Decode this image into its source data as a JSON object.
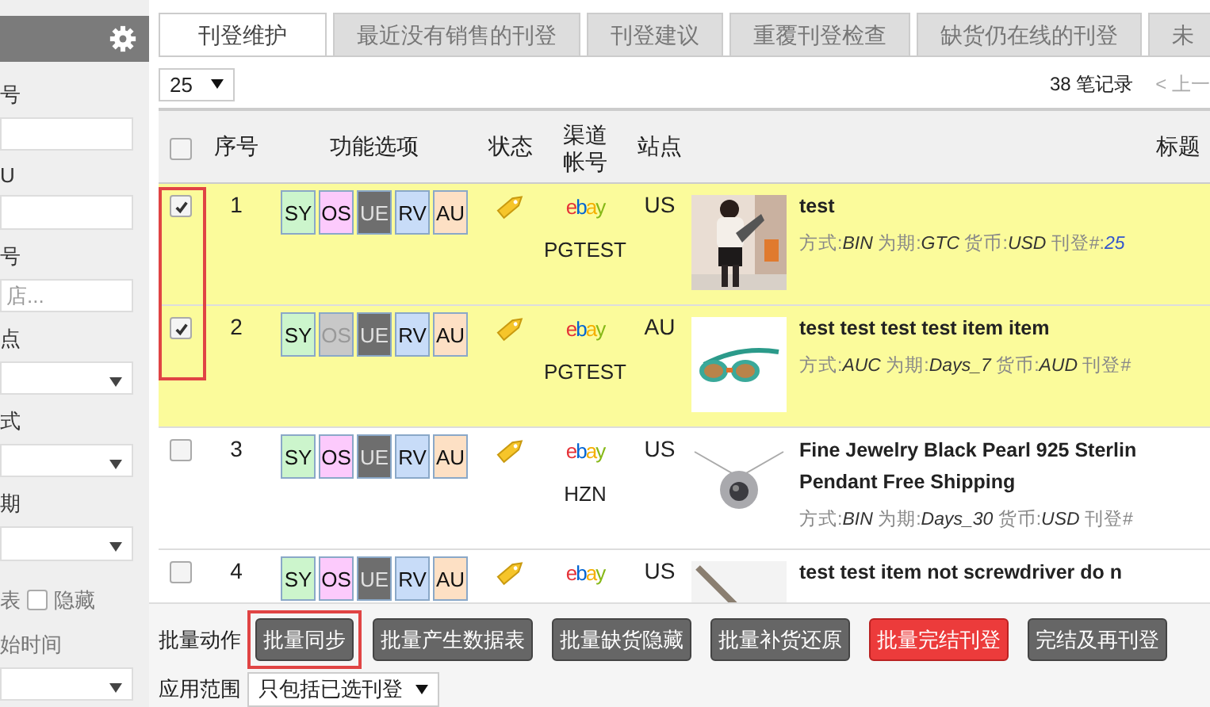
{
  "sidebar": {
    "fields": [
      {
        "kind": "input",
        "label": "号"
      },
      {
        "kind": "input",
        "label": "U"
      },
      {
        "kind": "input",
        "label": "号",
        "placeholder": "店..."
      },
      {
        "kind": "select",
        "label": "点"
      },
      {
        "kind": "select",
        "label": "式"
      },
      {
        "kind": "select",
        "label": "期"
      },
      {
        "kind": "checkbox",
        "prefix": "表",
        "label": "隐藏",
        "checked": false
      },
      {
        "kind": "select",
        "label": "始时间"
      }
    ]
  },
  "tabs": [
    {
      "label": "刊登维护",
      "selected": true
    },
    {
      "label": "最近没有销售的刊登",
      "selected": false
    },
    {
      "label": "刊登建议",
      "selected": false
    },
    {
      "label": "重覆刊登检查",
      "selected": false
    },
    {
      "label": "缺货仍在线的刊登",
      "selected": false
    },
    {
      "label": "未",
      "selected": false
    }
  ],
  "toolbar": {
    "page_size": "25",
    "record_count": "38 笔记录",
    "prev_page": "< 上一"
  },
  "table": {
    "select_all_checked": false,
    "columns": [
      "序号",
      "功能选项",
      "状态",
      "渠道帐号",
      "站点",
      "标题"
    ],
    "rows": [
      {
        "checked": true,
        "annotated": true,
        "index": "1",
        "actions": [
          {
            "code": "SY",
            "color": "#ccf5cc",
            "disabled": false
          },
          {
            "code": "OS",
            "color": "#fccafc",
            "disabled": false
          },
          {
            "code": "UE",
            "color": "#6e6e6e",
            "disabled": false
          },
          {
            "code": "RV",
            "color": "#c8dcf8",
            "disabled": false
          },
          {
            "code": "AU",
            "color": "#fde0c4",
            "disabled": false
          }
        ],
        "channel": {
          "kind": "ebay",
          "logo": "ebay"
        },
        "account": "PGTEST",
        "site": "US",
        "image": {
          "kind": "person"
        },
        "title": "test",
        "meta": [
          {
            "label": "方式:",
            "value": "BIN"
          },
          {
            "label": "为期:",
            "value": "GTC"
          },
          {
            "label": "货币:",
            "value": "USD"
          },
          {
            "label": "刊登#:",
            "value": "25"
          }
        ]
      },
      {
        "checked": true,
        "annotated": true,
        "index": "2",
        "actions": [
          {
            "code": "SY",
            "color": "#ccf5cc",
            "disabled": false
          },
          {
            "code": "OS",
            "disabled": true
          },
          {
            "code": "UE",
            "color": "#6e6e6e",
            "disabled": false
          },
          {
            "code": "RV",
            "color": "#c8dcf8",
            "disabled": false
          },
          {
            "code": "AU",
            "color": "#fde0c4",
            "disabled": false
          }
        ],
        "channel": {
          "kind": "ebay",
          "logo": "ebay"
        },
        "account": "PGTEST",
        "site": "AU",
        "image": {
          "kind": "goggles"
        },
        "title": "test test test test item item",
        "meta": [
          {
            "label": "方式:",
            "value": "AUC"
          },
          {
            "label": "为期:",
            "value": "Days_7"
          },
          {
            "label": "货币:",
            "value": "AUD"
          },
          {
            "label": "刊登#"
          }
        ]
      },
      {
        "checked": false,
        "annotated": false,
        "index": "3",
        "actions": [
          {
            "code": "SY",
            "color": "#ccf5cc",
            "disabled": false
          },
          {
            "code": "OS",
            "color": "#fccafc",
            "disabled": false
          },
          {
            "code": "UE",
            "color": "#6e6e6e",
            "disabled": false
          },
          {
            "code": "RV",
            "color": "#c8dcf8",
            "disabled": false
          },
          {
            "code": "AU",
            "color": "#fde0c4",
            "disabled": false
          }
        ],
        "channel": {
          "kind": "ebay",
          "logo": "ebay"
        },
        "account": "HZN",
        "site": "US",
        "image": {
          "kind": "pendant"
        },
        "title": "Fine Jewelry Black Pearl 925 Sterlin Pendant Free Shipping",
        "meta": [
          {
            "label": "方式:",
            "value": "BIN"
          },
          {
            "label": "为期:",
            "value": "Days_30"
          },
          {
            "label": "货币:",
            "value": "USD"
          },
          {
            "label": "刊登#"
          }
        ]
      },
      {
        "checked": false,
        "annotated": false,
        "index": "4",
        "actions": [
          {
            "code": "SY",
            "color": "#ccf5cc",
            "disabled": false
          },
          {
            "code": "OS",
            "color": "#fccafc",
            "disabled": false
          },
          {
            "code": "UE",
            "color": "#6e6e6e",
            "disabled": false
          },
          {
            "code": "RV",
            "color": "#c8dcf8",
            "disabled": false
          },
          {
            "code": "AU",
            "color": "#fde0c4",
            "disabled": false
          }
        ],
        "channel": {
          "kind": "ebay",
          "logo": "ebay"
        },
        "site": "US",
        "image": {
          "kind": "tool"
        },
        "title": "test test item not screwdriver do n"
      }
    ]
  },
  "batch": {
    "label": "批量动作",
    "buttons": [
      {
        "label": "批量同步",
        "kind": "normal",
        "highlighted": true
      },
      {
        "label": "批量产生数据表",
        "kind": "normal",
        "highlighted": false
      },
      {
        "label": "批量缺货隐藏",
        "kind": "normal",
        "highlighted": false
      },
      {
        "label": "批量补货还原",
        "kind": "normal",
        "highlighted": false
      },
      {
        "label": "批量完结刊登",
        "kind": "danger",
        "highlighted": false
      },
      {
        "label": "完结及再刊登",
        "kind": "normal",
        "highlighted": false
      }
    ],
    "scope_label": "应用范围",
    "scope_value": "只包括已选刊登"
  }
}
